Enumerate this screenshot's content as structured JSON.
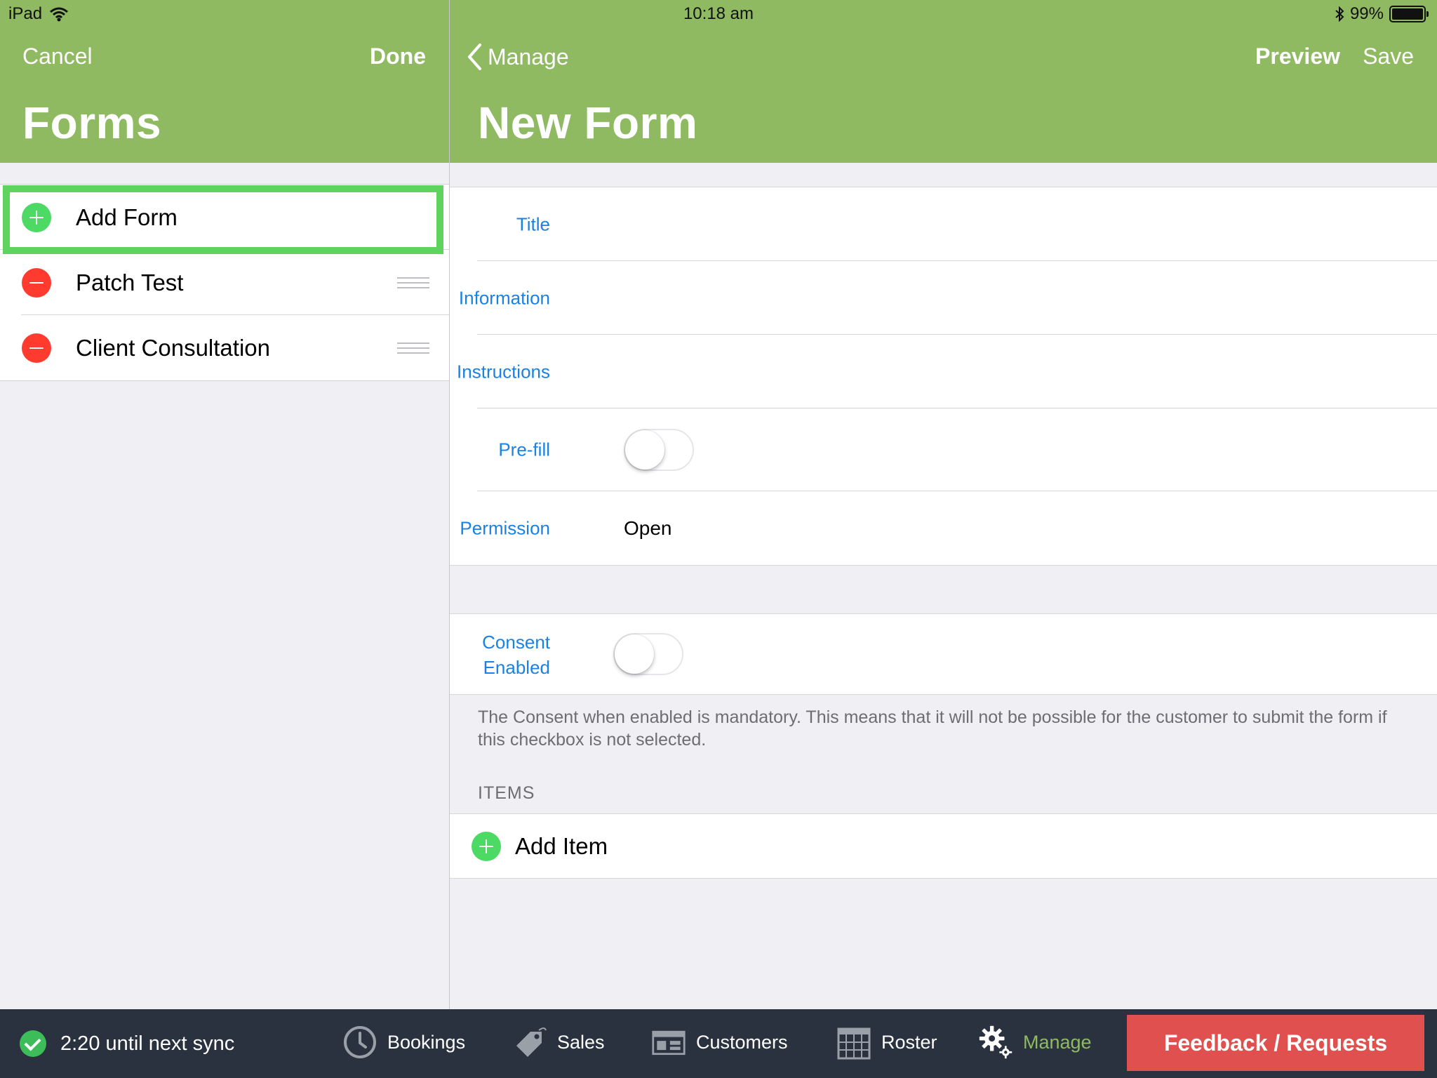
{
  "status_bar": {
    "device": "iPad",
    "time": "10:18 am",
    "battery": "99%"
  },
  "left_panel": {
    "cancel_label": "Cancel",
    "done_label": "Done",
    "title": "Forms",
    "add_form_label": "Add Form",
    "forms": [
      {
        "label": "Patch Test"
      },
      {
        "label": "Client Consultation"
      }
    ]
  },
  "right_panel": {
    "back_label": "Manage",
    "preview_label": "Preview",
    "save_label": "Save",
    "title": "New Form",
    "fields": {
      "title_label": "Title",
      "information_label": "Information",
      "instructions_label": "Instructions",
      "prefill_label": "Pre-fill",
      "prefill_on": false,
      "permission_label": "Permission",
      "permission_value": "Open"
    },
    "consent": {
      "label_line1": "Consent",
      "label_line2": "Enabled",
      "enabled": false,
      "note": "The Consent when enabled is mandatory. This means that it will not be possible for the customer to submit the form if this checkbox is not selected."
    },
    "items_header": "ITEMS",
    "add_item_label": "Add Item"
  },
  "bottom_bar": {
    "sync_text": "2:20 until next sync",
    "tabs": [
      {
        "label": "Bookings",
        "icon": "clock-icon"
      },
      {
        "label": "Sales",
        "icon": "price-tag-icon"
      },
      {
        "label": "Customers",
        "icon": "storefront-icon"
      },
      {
        "label": "Roster",
        "icon": "calendar-icon"
      },
      {
        "label": "Manage",
        "icon": "gears-icon",
        "active": true
      }
    ],
    "feedback_label": "Feedback / Requests"
  },
  "colors": {
    "header_green": "#8fba62",
    "link_blue": "#1a82e2",
    "add_green": "#4cd964",
    "delete_red": "#ff3b30",
    "feedback_red": "#e0504e",
    "bottom_bar": "#2a3240"
  }
}
